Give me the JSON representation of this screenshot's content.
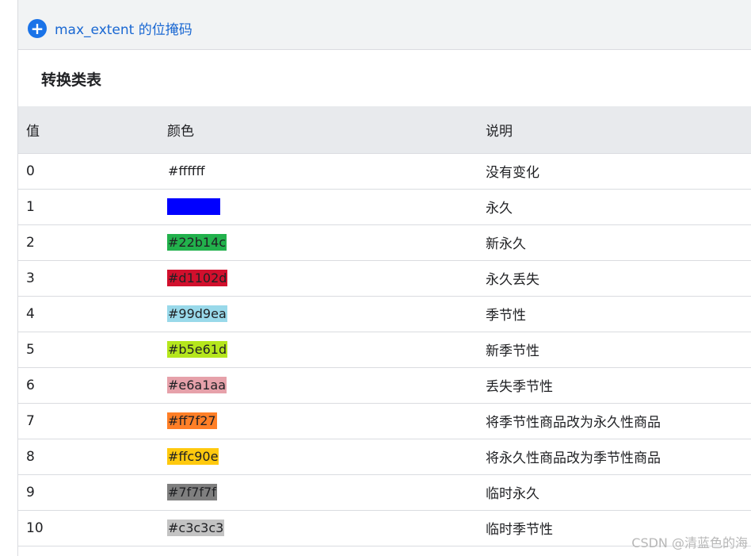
{
  "expand": {
    "label": "max_extent 的位掩码"
  },
  "section": {
    "title": "转换类表"
  },
  "table": {
    "headers": [
      "值",
      "颜色",
      "说明"
    ],
    "rows": [
      {
        "value": "0",
        "color": "#ffffff",
        "bg": "#ffffff",
        "fg": "#202124",
        "desc": "没有变化"
      },
      {
        "value": "1",
        "color": "#0000ff",
        "bg": "#0000ff",
        "fg": "#0000ff",
        "desc": "永久"
      },
      {
        "value": "2",
        "color": "#22b14c",
        "bg": "#22b14c",
        "fg": "#202124",
        "desc": "新永久"
      },
      {
        "value": "3",
        "color": "#d1102d",
        "bg": "#d1102d",
        "fg": "#202124",
        "desc": "永久丢失"
      },
      {
        "value": "4",
        "color": "#99d9ea",
        "bg": "#99d9ea",
        "fg": "#202124",
        "desc": "季节性"
      },
      {
        "value": "5",
        "color": "#b5e61d",
        "bg": "#b5e61d",
        "fg": "#202124",
        "desc": "新季节性"
      },
      {
        "value": "6",
        "color": "#e6a1aa",
        "bg": "#e6a1aa",
        "fg": "#202124",
        "desc": "丢失季节性"
      },
      {
        "value": "7",
        "color": "#ff7f27",
        "bg": "#ff7f27",
        "fg": "#202124",
        "desc": "将季节性商品改为永久性商品"
      },
      {
        "value": "8",
        "color": "#ffc90e",
        "bg": "#ffc90e",
        "fg": "#202124",
        "desc": "将永久性商品改为季节性商品"
      },
      {
        "value": "9",
        "color": "#7f7f7f",
        "bg": "#7f7f7f",
        "fg": "#202124",
        "desc": "临时永久"
      },
      {
        "value": "10",
        "color": "#c3c3c3",
        "bg": "#c3c3c3",
        "fg": "#202124",
        "desc": "临时季节性"
      }
    ]
  },
  "watermark": "CSDN @清蓝色的海",
  "icons": {
    "expand": "plus-circle-icon"
  }
}
